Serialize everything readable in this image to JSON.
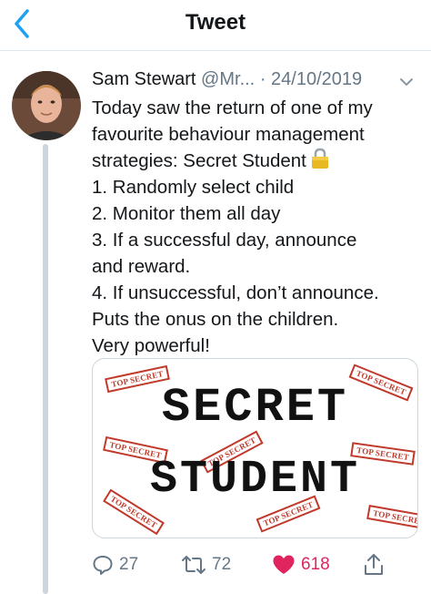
{
  "nav": {
    "title": "Tweet"
  },
  "tweet": {
    "author_name": "Sam Stewart",
    "handle": "@Mr...",
    "separator": "·",
    "date": "24/10/2019",
    "text_lines": [
      "Today saw the return of one of my",
      "favourite behaviour management",
      "strategies: Secret Student",
      "1. Randomly select child",
      "2. Monitor them all day",
      "3. If a successful day, announce",
      "and reward.",
      "4. If unsuccessful, don’t announce.",
      "Puts the onus on the children.",
      "Very powerful!"
    ],
    "media": {
      "line1": "SECRET",
      "line2": "STUDENT",
      "stamp_text": "TOP SECRET"
    },
    "actions": {
      "replies": "27",
      "retweets": "72",
      "likes": "618"
    }
  },
  "colors": {
    "accent": "#1da1f2",
    "like": "#e0245e",
    "muted": "#657786",
    "stamp": "#c0392b"
  },
  "icons": {
    "back": "chevron-left-icon",
    "more": "chevron-down-icon",
    "lock": "lock-icon",
    "reply": "reply-icon",
    "retweet": "retweet-icon",
    "like": "heart-icon",
    "share": "share-icon"
  }
}
